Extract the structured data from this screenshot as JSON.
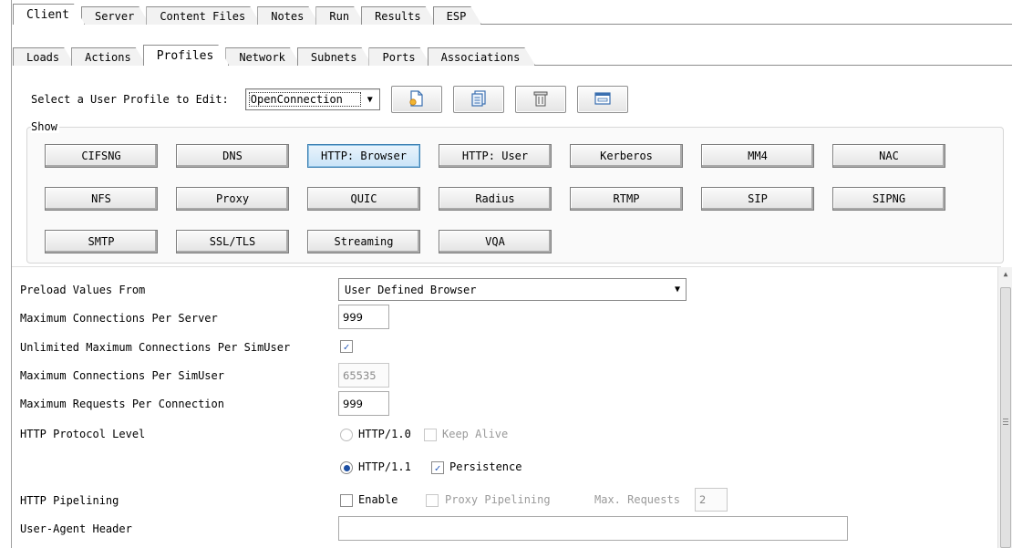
{
  "tabs_top": [
    "Client",
    "Server",
    "Content Files",
    "Notes",
    "Run",
    "Results",
    "ESP"
  ],
  "tabs_top_active": "Client",
  "tabs_sub": [
    "Loads",
    "Actions",
    "Profiles",
    "Network",
    "Subnets",
    "Ports",
    "Associations"
  ],
  "tabs_sub_active": "Profiles",
  "profile_select": {
    "label": "Select a User Profile to Edit:",
    "value": "OpenConnection",
    "icons": [
      "new-profile-icon",
      "copy-profile-icon",
      "delete-profile-icon",
      "rename-profile-icon"
    ]
  },
  "show": {
    "label": "Show",
    "buttons": [
      "CIFSNG",
      "DNS",
      "HTTP: Browser",
      "HTTP: User",
      "Kerberos",
      "MM4",
      "NAC",
      "NFS",
      "Proxy",
      "QUIC",
      "Radius",
      "RTMP",
      "SIP",
      "SIPNG",
      "SMTP",
      "SSL/TLS",
      "Streaming",
      "VQA"
    ],
    "selected": "HTTP: Browser"
  },
  "form": {
    "preload_label": "Preload Values From",
    "preload_value": "User Defined Browser",
    "max_conn_server_label": "Maximum Connections Per Server",
    "max_conn_server_value": "999",
    "unlimited_label": "Unlimited Maximum Connections Per SimUser",
    "unlimited_checked": true,
    "max_conn_simuser_label": "Maximum Connections Per SimUser",
    "max_conn_simuser_value": "65535",
    "max_req_label": "Maximum Requests Per Connection",
    "max_req_value": "999",
    "protocol_label": "HTTP Protocol Level",
    "http10_label": "HTTP/1.0",
    "keep_alive_label": "Keep Alive",
    "http11_label": "HTTP/1.1",
    "persistence_label": "Persistence",
    "persistence_checked": true,
    "pipelining_label": "HTTP Pipelining",
    "enable_label": "Enable",
    "proxy_pipelining_label": "Proxy Pipelining",
    "max_requests_label": "Max. Requests",
    "max_requests_value": "2",
    "user_agent_label": "User-Agent Header",
    "user_agent_value": ""
  },
  "colors": {
    "selected_button": "#c9e3f7",
    "check_blue": "#2255b5"
  }
}
